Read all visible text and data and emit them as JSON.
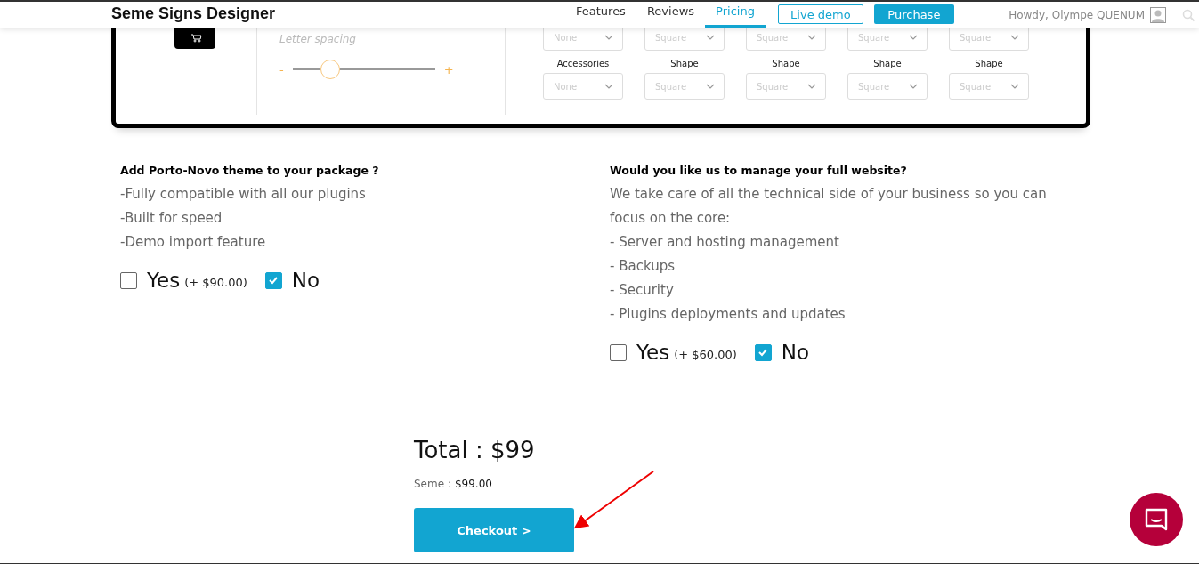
{
  "header": {
    "title": "Seme Signs Designer",
    "nav": [
      {
        "label": "Features",
        "selected": false
      },
      {
        "label": "Reviews",
        "selected": false
      },
      {
        "label": "Pricing",
        "selected": true
      }
    ],
    "live_demo": "Live demo",
    "purchase": "Purchase",
    "greeting": "Howdy, Olympe QUENUM"
  },
  "designer": {
    "letter_spacing": "Letter spacing",
    "slider": {
      "minus": "-",
      "plus": "+",
      "level": 0.26
    },
    "rows": [
      {
        "labels": [],
        "selects": [
          "None",
          "Square",
          "Square",
          "Square",
          "Square"
        ]
      },
      {
        "labels": [
          "Accessories",
          "Shape",
          "Shape",
          "Shape",
          "Shape"
        ],
        "selects": [
          "None",
          "Square",
          "Square",
          "Square",
          "Square"
        ]
      }
    ]
  },
  "addons": [
    {
      "heading": "Add Porto-Novo theme to your package ?",
      "lines": [
        "-Fully compatible with all our plugins",
        "-Built for speed",
        "-Demo import feature"
      ],
      "options": [
        {
          "label": "Yes",
          "price": "(+ $90.00)",
          "checked": false
        },
        {
          "label": "No",
          "checked": true
        }
      ]
    },
    {
      "heading": "Would you like us to manage your full website?",
      "intro": "We take care of all the technical side of your business so you can focus on the core:",
      "lines": [
        "- Server and hosting management",
        "- Backups",
        "- Security",
        "- Plugins deployments and updates"
      ],
      "options": [
        {
          "label": "Yes",
          "price": "(+ $60.00)",
          "checked": false
        },
        {
          "label": "No",
          "checked": true
        }
      ]
    }
  ],
  "summary": {
    "total": "Total : $99",
    "item_label": "Seme :",
    "item_price": "$99.00",
    "checkout": "Checkout >"
  }
}
